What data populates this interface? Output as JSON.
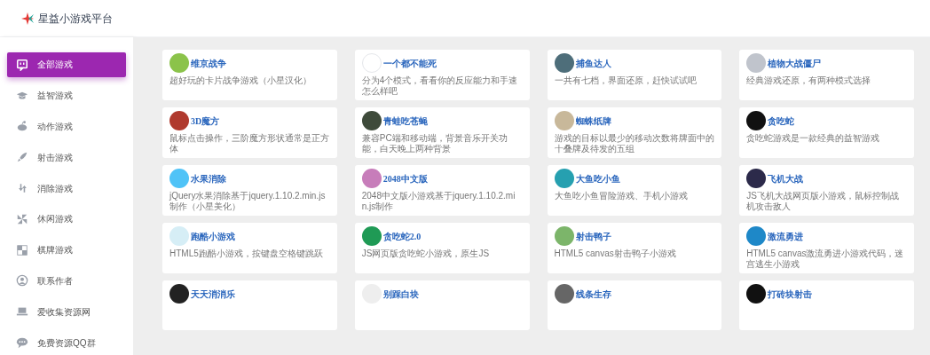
{
  "header": {
    "title": "星益小游戏平台"
  },
  "sidebar": {
    "items": [
      {
        "label": "全部游戏",
        "selected": true
      },
      {
        "label": "益智游戏",
        "selected": false
      },
      {
        "label": "动作游戏",
        "selected": false
      },
      {
        "label": "射击游戏",
        "selected": false
      },
      {
        "label": "消除游戏",
        "selected": false
      },
      {
        "label": "休闲游戏",
        "selected": false
      },
      {
        "label": "棋牌游戏",
        "selected": false
      },
      {
        "label": "联系作者",
        "selected": false
      },
      {
        "label": "爱收集资源网",
        "selected": false
      },
      {
        "label": "免费资源QQ群",
        "selected": false
      }
    ]
  },
  "games": [
    {
      "title": "维京战争",
      "description": "超好玩的卡片战争游戏（小星汉化）"
    },
    {
      "title": "一个都不能死",
      "description": "分为4个模式，看看你的反应能力和手速怎么样吧"
    },
    {
      "title": "捕鱼达人",
      "description": "一共有七档，界面还原，赶快试试吧"
    },
    {
      "title": "植物大战僵尸",
      "description": "经典游戏还原，有两种模式选择"
    },
    {
      "title": "3D魔方",
      "description": "鼠标点击操作，三阶魔方形状通常是正方体"
    },
    {
      "title": "青蛙吃苍蝇",
      "description": "兼容PC端和移动端，背景音乐开关功能，白天晚上两种背景"
    },
    {
      "title": "蜘蛛纸牌",
      "description": "游戏的目标以最少的移动次数将牌面中的十叠牌及待发的五组"
    },
    {
      "title": "贪吃蛇",
      "description": "贪吃蛇游戏是一款经典的益智游戏"
    },
    {
      "title": "水果消除",
      "description": "jQuery水果消除基于jquery.1.10.2.min.js制作（小星美化）"
    },
    {
      "title": "2048中文版",
      "description": "2048中文版小游戏基于jquery.1.10.2.min.js制作"
    },
    {
      "title": "大鱼吃小鱼",
      "description": "大鱼吃小鱼冒险游戏、手机小游戏"
    },
    {
      "title": "飞机大战",
      "description": "JS飞机大战网页版小游戏，鼠标控制战机攻击敌人"
    },
    {
      "title": "跑酷小游戏",
      "description": "HTML5跑酷小游戏，按键盘空格键跳跃"
    },
    {
      "title": "贪吃蛇2.0",
      "description": "JS网页版贪吃蛇小游戏，原生JS"
    },
    {
      "title": "射击鸭子",
      "description": "HTML5 canvas射击鸭子小游戏"
    },
    {
      "title": "激流勇进",
      "description": "HTML5 canvas激流勇进小游戏代码，迷宫逃生小游戏"
    },
    {
      "title": "天天消消乐"
    },
    {
      "title": "别踩白块"
    },
    {
      "title": "线条生存"
    },
    {
      "title": "打砖块射击"
    }
  ]
}
